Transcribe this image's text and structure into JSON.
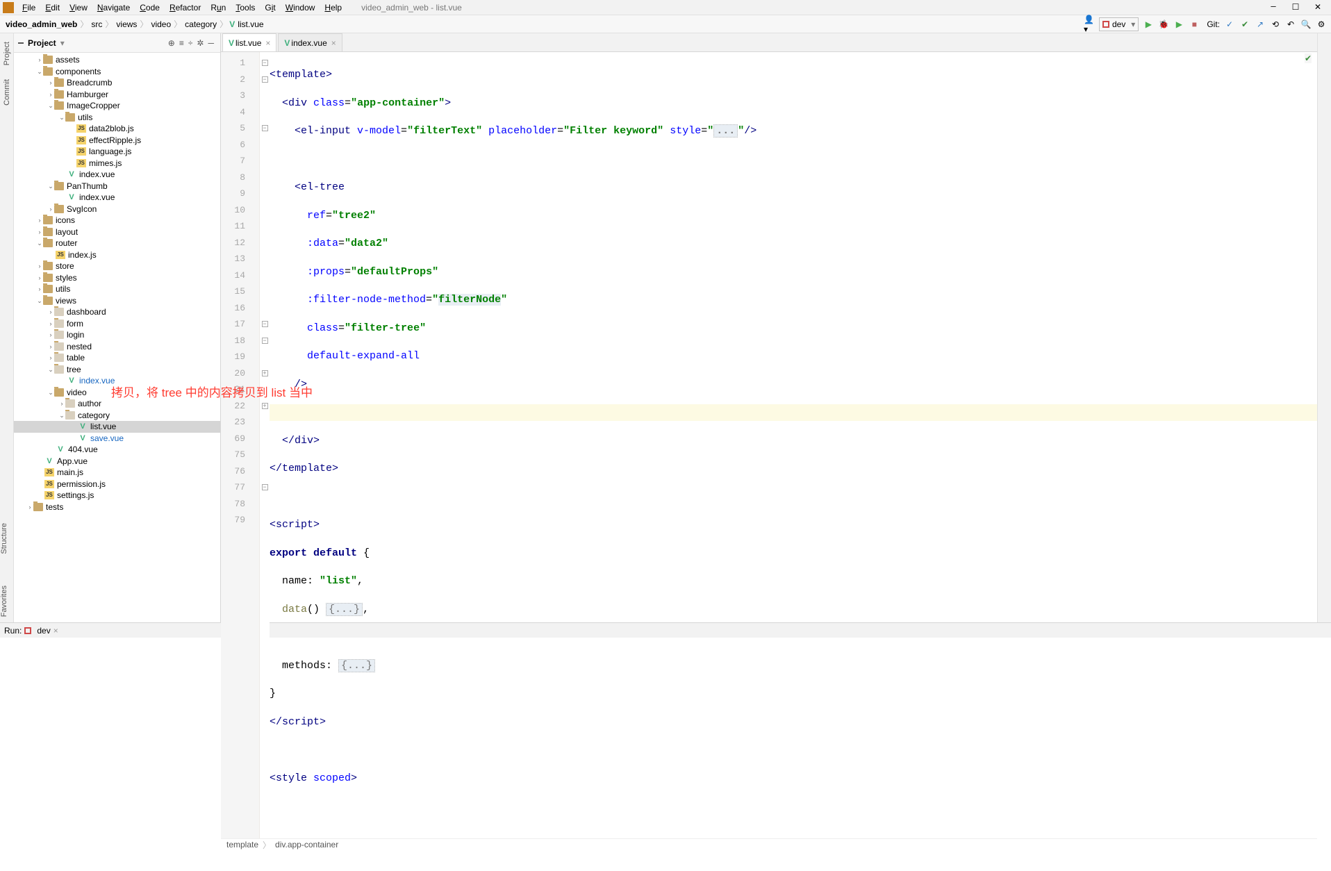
{
  "window_title": "video_admin_web - list.vue",
  "menu": [
    "File",
    "Edit",
    "View",
    "Navigate",
    "Code",
    "Refactor",
    "Run",
    "Tools",
    "Git",
    "Window",
    "Help"
  ],
  "breadcrumb": [
    "video_admin_web",
    "src",
    "views",
    "video",
    "category",
    "list.vue"
  ],
  "nav_right": {
    "run_config": "dev",
    "git_label": "Git:"
  },
  "project_header": "Project",
  "tree": {
    "assets": "assets",
    "components": "components",
    "breadcrumb": "Breadcrumb",
    "hamburger": "Hamburger",
    "imagecropper": "ImageCropper",
    "utils": "utils",
    "d2b": "data2blob.js",
    "er": "effectRipple.js",
    "lang": "language.js",
    "mim": "mimes.js",
    "idx1": "index.vue",
    "panthumb": "PanThumb",
    "idx2": "index.vue",
    "svgicon": "SvgIcon",
    "icons": "icons",
    "layout": "layout",
    "router": "router",
    "idxjs": "index.js",
    "store": "store",
    "styles": "styles",
    "utils2": "utils",
    "views": "views",
    "dashboard": "dashboard",
    "form": "form",
    "login": "login",
    "nested": "nested",
    "table": "table",
    "treef": "tree",
    "idx3": "index.vue",
    "video": "video",
    "author": "author",
    "category": "category",
    "listvue": "list.vue",
    "savevue": "save.vue",
    "f404": "404.vue",
    "appvue": "App.vue",
    "mainjs": "main.js",
    "permjs": "permission.js",
    "setjs": "settings.js",
    "tests": "tests"
  },
  "tabs": [
    {
      "label": "list.vue",
      "active": true
    },
    {
      "label": "index.vue",
      "active": false
    }
  ],
  "line_numbers": [
    "1",
    "2",
    "3",
    "4",
    "5",
    "6",
    "7",
    "8",
    "9",
    "10",
    "11",
    "12",
    "13",
    "14",
    "15",
    "16",
    "17",
    "18",
    "19",
    "20",
    "21",
    "22",
    "23",
    "69",
    "75",
    "76",
    "77",
    "78",
    "79"
  ],
  "code_lines": {
    "l1a": "<template>",
    "l2": "  <div class=\"app-container\">",
    "l3": "    <el-input v-model=\"filterText\" placeholder=\"Filter keyword\" style=\"...\"/>",
    "l5": "    <el-tree",
    "l6": "      ref=\"tree2\"",
    "l7": "      :data=\"data2\"",
    "l8": "      :props=\"defaultProps\"",
    "l9": "      :filter-node-method=\"filterNode\"",
    "l10": "      class=\"filter-tree\"",
    "l11": "      default-expand-all",
    "l12": "    />",
    "l14": "  </div>",
    "l15": "</template>",
    "l17": "<script>",
    "l18": "export default {",
    "l19": "  name: \"list\",",
    "l20": "  data() {...},",
    "l69": "  methods: {...}",
    "l75": "}",
    "l76": "</script>",
    "l78": "<style scoped>"
  },
  "editor_crumb": [
    "template",
    "div.app-container"
  ],
  "bottom": {
    "run_label": "Run:",
    "run_config": "dev"
  },
  "side_labels": {
    "project": "Project",
    "commit": "Commit",
    "structure": "Structure",
    "favorites": "Favorites"
  },
  "annotation": "拷贝，将 tree 中的内容拷贝到 list 当中"
}
